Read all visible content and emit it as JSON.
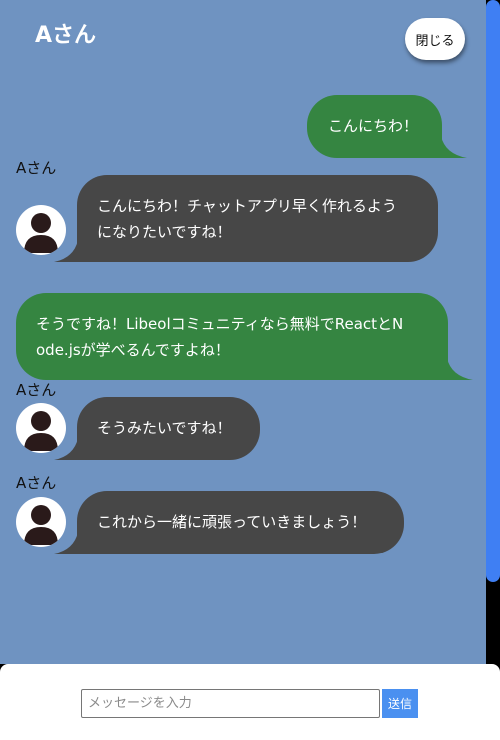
{
  "header": {
    "title": "Aさん",
    "close_label": "閉じる"
  },
  "messages": [
    {
      "from": "me",
      "text": "こんにちわ！"
    },
    {
      "from": "other",
      "sender": "Aさん",
      "lines": [
        "こんにちわ！チャットアプリ早く作れるよう",
        "になりたいですね！"
      ]
    },
    {
      "from": "me",
      "lines": [
        "そうですね！Libeolコミュニティなら無料でReactとN",
        "ode.jsが学べるんですよね！"
      ]
    },
    {
      "from": "other",
      "sender": "Aさん",
      "text": "そうみたいですね！"
    },
    {
      "from": "other",
      "sender": "Aさん",
      "text": "これから一緒に頑張っていきましょう！"
    }
  ],
  "composer": {
    "placeholder": "メッセージを入力",
    "value": "",
    "send_label": "送信"
  },
  "colors": {
    "panel_bg": "#6f93c1",
    "my_bubble": "#358541",
    "their_bubble": "#474747",
    "scroll_thumb": "#3f7ff3",
    "send_button": "#4a90f0"
  },
  "icons": {
    "avatar": "user-silhouette-icon"
  }
}
